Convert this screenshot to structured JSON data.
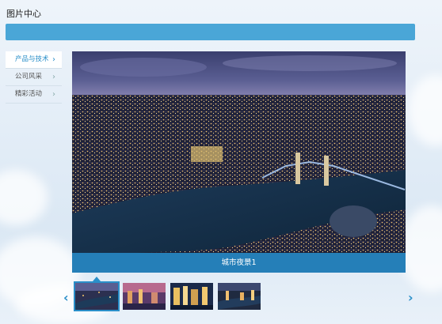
{
  "page": {
    "title": "图片中心"
  },
  "sidebar": {
    "items": [
      {
        "label": "产品与技术",
        "active": true
      },
      {
        "label": "公司风采",
        "active": false
      },
      {
        "label": "精彩活动",
        "active": false
      }
    ]
  },
  "slider": {
    "caption": "城市夜景1",
    "active_index": 0,
    "thumbnails": [
      {
        "icon": "city-night-thumb-1"
      },
      {
        "icon": "city-night-thumb-2"
      },
      {
        "icon": "city-night-thumb-3"
      },
      {
        "icon": "city-night-thumb-4"
      }
    ],
    "prev_icon": "chevron-left-icon",
    "next_icon": "chevron-right-icon"
  },
  "colors": {
    "accent": "#4aa6d7",
    "caption_bg": "#268cc8"
  }
}
